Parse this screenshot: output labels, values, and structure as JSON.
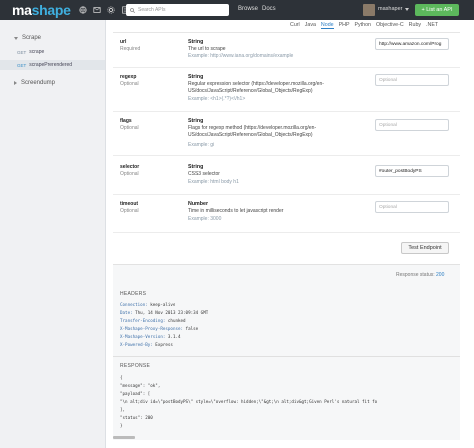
{
  "topbar": {
    "logo_part1": "ma",
    "logo_part2": "shape",
    "search_placeholder": "Search APIs",
    "browse": "Browse",
    "docs": "Docs",
    "username": "mashaper",
    "list_api": "+ List an API"
  },
  "sidebar": {
    "section1": "Scrape",
    "endpoints": [
      {
        "method": "GET",
        "name": "scrape",
        "active": false
      },
      {
        "method": "GET",
        "name": "scrapePrerendered",
        "active": true
      }
    ],
    "section2": "Screendump"
  },
  "langs": [
    "Curl",
    "Java",
    "Node",
    "PHP",
    "Python",
    "Objective-C",
    "Ruby",
    ".NET"
  ],
  "active_lang": "Node",
  "params": [
    {
      "name": "url",
      "req": "Required",
      "type": "String",
      "desc": "The url to scrape",
      "example": "Example: http://www.iana.org/domains/example",
      "value": "http://www.amazon.com/Prog",
      "placeholder": ""
    },
    {
      "name": "regexp",
      "req": "Optional",
      "type": "String",
      "desc": "Regular expression selector (https://developer.mozilla.org/en-US/docs/JavaScript/Reference/Global_Objects/RegExp)",
      "example": "Example: <h1>(.*?)<\\/h1>",
      "value": "",
      "placeholder": "Optional"
    },
    {
      "name": "flags",
      "req": "Optional",
      "type": "String",
      "desc": "Flags for regexp method (https://developer.mozilla.org/en-US/docs/JavaScript/Reference/Global_Objects/RegExp)",
      "example": "Example: gi",
      "value": "",
      "placeholder": "Optional"
    },
    {
      "name": "selector",
      "req": "Optional",
      "type": "String",
      "desc": "CSS3 selector",
      "example": "Example: html body h1",
      "value": "#outer_postBodyPS",
      "placeholder": ""
    },
    {
      "name": "timeout",
      "req": "Optional",
      "type": "Number",
      "desc": "Time in milliseconds to let javascript render",
      "example": "Example: 3000",
      "value": "",
      "placeholder": "Optional"
    }
  ],
  "test_button": "Test Endpoint",
  "response_status_label": "Response status:",
  "response_status_code": "200",
  "headers_title": "HEADERS",
  "headers": [
    {
      "k": "Connection:",
      "v": " keep-alive"
    },
    {
      "k": "Date:",
      "v": " Thu, 14 Nov 2013 23:09:34 GMT"
    },
    {
      "k": "Transfer-Encoding:",
      "v": " chunked"
    },
    {
      "k": "X-Mashape-Proxy-Response:",
      "v": " false"
    },
    {
      "k": "X-Mashape-Version:",
      "v": " 3.1.4"
    },
    {
      "k": "X-Powered-By:",
      "v": " Express"
    }
  ],
  "response_title": "RESPONSE",
  "code_lines": [
    "{",
    "  \"message\": \"ok\",",
    "  \"payload\": [",
    "    \"\\n        alt;div id=\\\"postBodyPS\\\" style=\\\"overflow: hidden;\\\"&gt;\\n        alt;div&gt;Given Perl's natural fit fo",
    "  ],",
    "  \"status\": 200",
    "}"
  ]
}
